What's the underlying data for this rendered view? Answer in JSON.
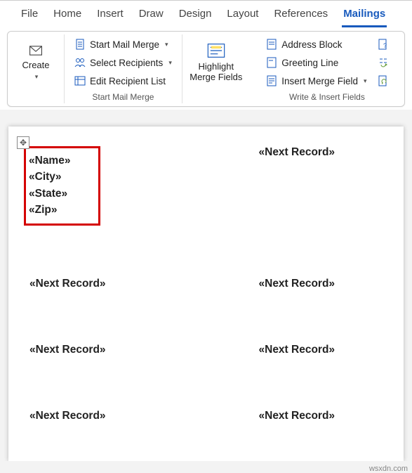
{
  "tabs": {
    "file": "File",
    "home": "Home",
    "insert": "Insert",
    "draw": "Draw",
    "design": "Design",
    "layout": "Layout",
    "references": "References",
    "mailings": "Mailings"
  },
  "ribbon": {
    "create": {
      "label": "Create"
    },
    "startGroup": {
      "startMailMerge": "Start Mail Merge",
      "selectRecipients": "Select Recipients",
      "editRecipientList": "Edit Recipient List",
      "label": "Start Mail Merge"
    },
    "highlight": {
      "line1": "Highlight",
      "line2": "Merge Fields"
    },
    "writeGroup": {
      "addressBlock": "Address Block",
      "greetingLine": "Greeting Line",
      "insertMergeField": "Insert Merge Field",
      "label": "Write & Insert Fields"
    }
  },
  "document": {
    "fields": [
      "«Name»",
      "«City»",
      "«State»",
      "«Zip»"
    ],
    "nextRecord": "«Next Record»"
  },
  "watermark": "wsxdn.com"
}
